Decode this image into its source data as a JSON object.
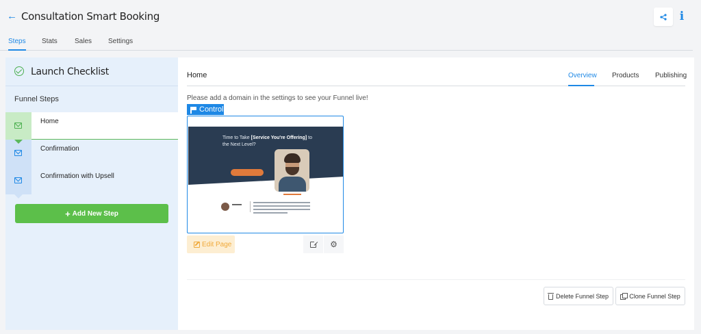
{
  "header": {
    "back_icon": "arrow-left-icon",
    "title": "Consultation Smart Booking",
    "share_icon": "share-icon",
    "info_icon": "info-icon",
    "info_glyph": "i"
  },
  "top_tabs": [
    {
      "label": "Steps",
      "active": true
    },
    {
      "label": "Stats",
      "active": false
    },
    {
      "label": "Sales",
      "active": false
    },
    {
      "label": "Settings",
      "active": false
    }
  ],
  "sidebar": {
    "checklist_label": "Launch Checklist",
    "funnel_steps_title": "Funnel Steps",
    "steps": [
      {
        "label": "Home",
        "active": true,
        "icon": "envelope-icon"
      },
      {
        "label": "Confirmation",
        "active": false,
        "icon": "envelope-icon"
      },
      {
        "label": "Confirmation with Upsell",
        "active": false,
        "icon": "envelope-icon"
      }
    ],
    "add_step_label": "Add New Step"
  },
  "main": {
    "step_title": "Home",
    "sub_tabs": [
      {
        "label": "Overview",
        "active": true
      },
      {
        "label": "Products",
        "active": false
      },
      {
        "label": "Publishing",
        "active": false
      }
    ],
    "domain_message": "Please add a domain in the settings to see your Funnel live!",
    "control_badge": "Control",
    "preview": {
      "headline_prefix": "Time to Take ",
      "headline_bold": "[Service You're Offering]",
      "headline_suffix": " to the Next Level?"
    },
    "edit_page_label": "Edit Page",
    "delete_label": "Delete Funnel Step",
    "clone_label": "Clone Funnel Step"
  },
  "colors": {
    "accent": "#1e88e5",
    "success": "#5cbf4a",
    "warning": "#f0a93a",
    "sidebar_bg": "#e6f0fb"
  }
}
